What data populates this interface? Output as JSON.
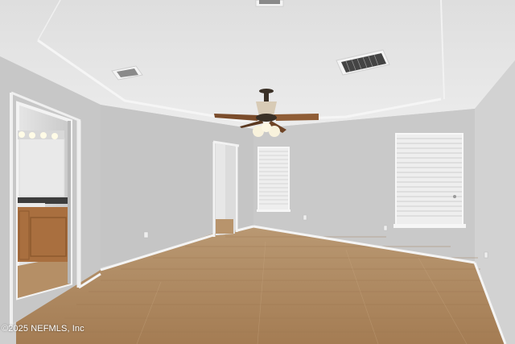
{
  "watermark": {
    "text": "©2025 NEFMLS, Inc"
  },
  "colors": {
    "ceiling": "#e6e6e6",
    "wall_back": "#c9c9c9",
    "wall_left": "#c4c4c4",
    "wall_right": "#d0d0d0",
    "floor": "#b08b63",
    "trim": "#f2f2f2",
    "cabinet": "#a86f3e"
  },
  "icons": [
    "ceiling-fan-icon",
    "air-vent-icon",
    "window-blinds-icon",
    "vanity-light-icon",
    "power-outlet-icon"
  ]
}
